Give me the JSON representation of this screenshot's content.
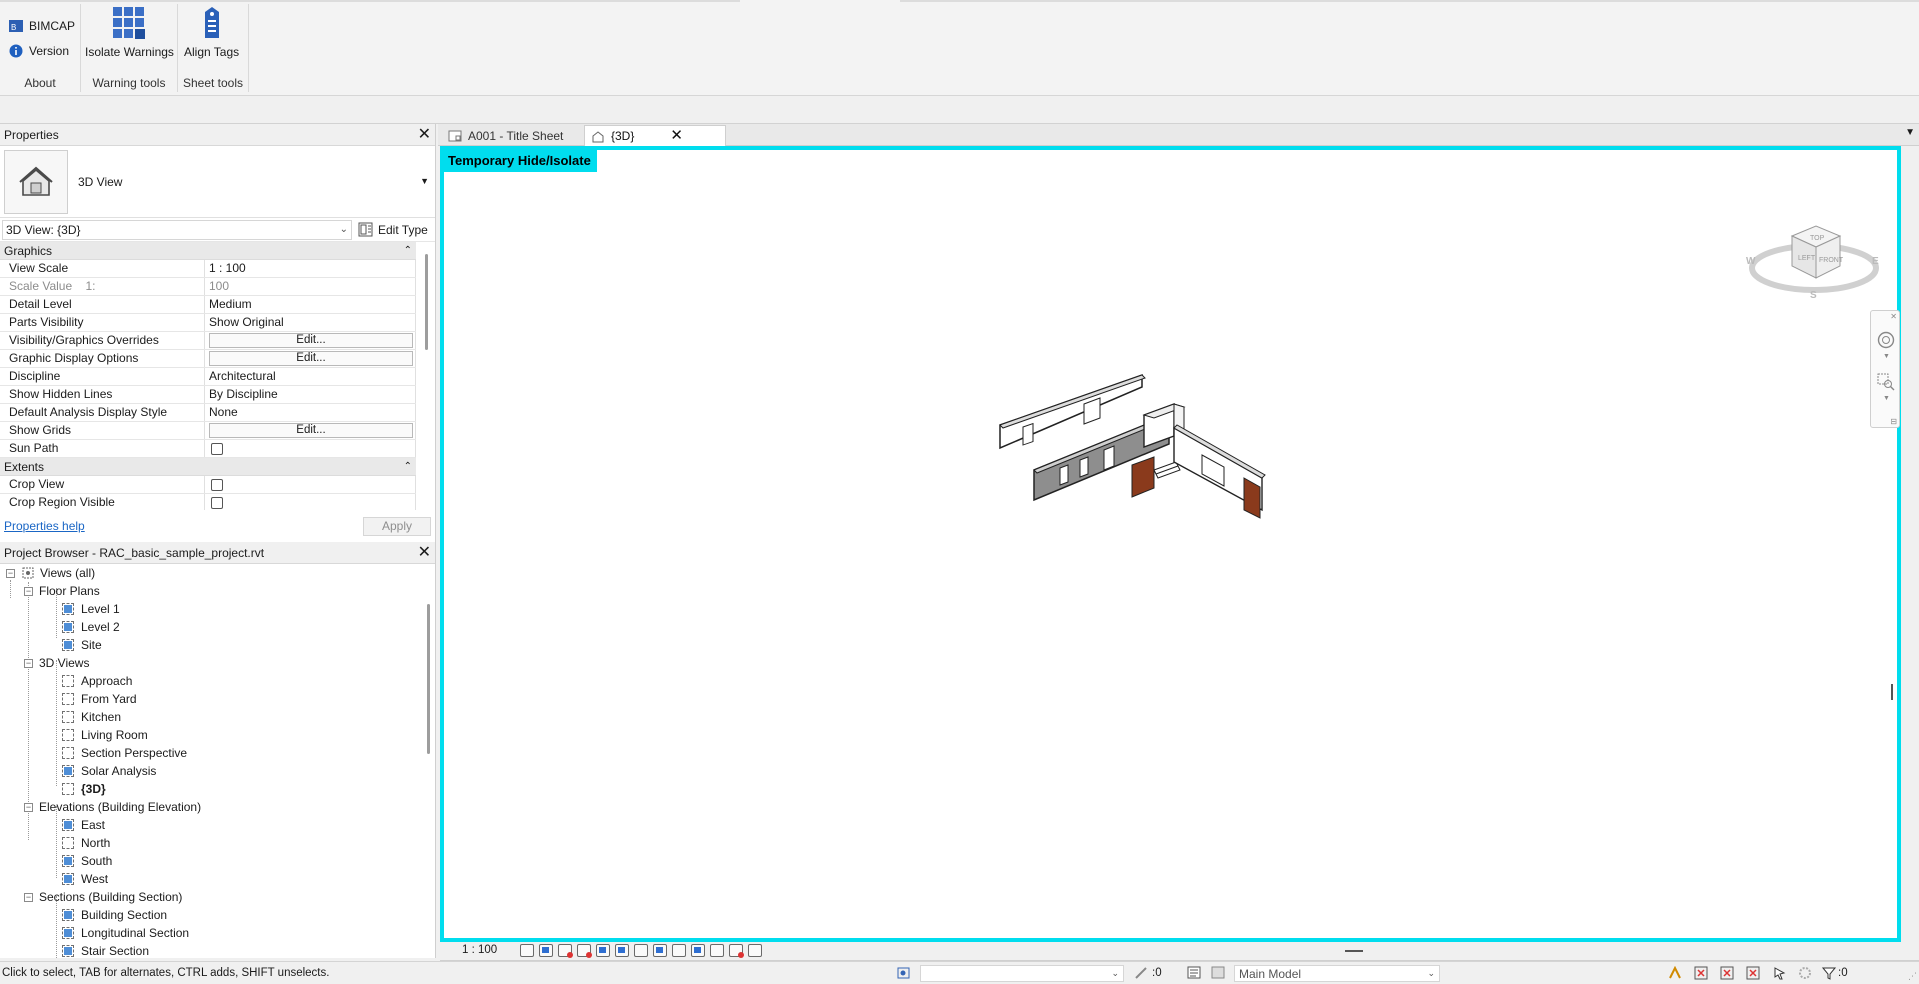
{
  "ribbon": {
    "about": {
      "bimcap_label": "BIMCAP",
      "version_label": "Version",
      "panel_title": "About"
    },
    "warning_tools": {
      "isolate_label": "Isolate Warnings",
      "panel_title": "Warning tools"
    },
    "sheet_tools": {
      "align_label": "Align Tags",
      "panel_title": "Sheet tools"
    }
  },
  "properties": {
    "title": "Properties",
    "type_name": "3D View",
    "instance_selector": "3D View: {3D}",
    "edit_type_label": "Edit Type",
    "groups": {
      "graphics": "Graphics",
      "extents": "Extents"
    },
    "rows": {
      "view_scale": {
        "name": "View Scale",
        "value": "1 : 100"
      },
      "scale_value": {
        "name": "Scale Value    1:",
        "value": "100"
      },
      "detail_level": {
        "name": "Detail Level",
        "value": "Medium"
      },
      "parts_visibility": {
        "name": "Parts Visibility",
        "value": "Show Original"
      },
      "vg_overrides": {
        "name": "Visibility/Graphics Overrides",
        "value": "Edit..."
      },
      "graphic_display": {
        "name": "Graphic Display Options",
        "value": "Edit..."
      },
      "discipline": {
        "name": "Discipline",
        "value": "Architectural"
      },
      "hidden_lines": {
        "name": "Show Hidden Lines",
        "value": "By Discipline"
      },
      "analysis_style": {
        "name": "Default Analysis Display Style",
        "value": "None"
      },
      "show_grids": {
        "name": "Show Grids",
        "value": "Edit..."
      },
      "sun_path": {
        "name": "Sun Path"
      },
      "crop_view": {
        "name": "Crop View"
      },
      "crop_region_visible": {
        "name": "Crop Region Visible"
      }
    },
    "help_link": "Properties help",
    "apply_label": "Apply"
  },
  "browser": {
    "title": "Project Browser - RAC_basic_sample_project.rvt",
    "root": "Views (all)",
    "floor_plans": {
      "label": "Floor Plans",
      "items": [
        "Level 1",
        "Level 2",
        "Site"
      ]
    },
    "views_3d": {
      "label": "3D Views",
      "items": [
        "Approach",
        "From Yard",
        "Kitchen",
        "Living Room",
        "Section Perspective",
        "Solar Analysis",
        "{3D}"
      ]
    },
    "elevations": {
      "label": "Elevations (Building Elevation)",
      "items": [
        "East",
        "North",
        "South",
        "West"
      ]
    },
    "sections": {
      "label": "Sections (Building Section)",
      "items": [
        "Building Section",
        "Longitudinal Section",
        "Stair Section"
      ]
    }
  },
  "view_tabs": {
    "tab1": "A001 - Title Sheet",
    "tab2": "{3D}"
  },
  "view": {
    "temp_hide_label": "Temporary Hide/Isolate",
    "accent_color": "#00ddee",
    "viewcube": {
      "top": "TOP",
      "left": "LEFT",
      "front": "FRONT",
      "w": "W",
      "e": "E",
      "s": "S"
    }
  },
  "view_bar": {
    "scale": "1 : 100"
  },
  "status": {
    "text": "Click to select, TAB for alternates, CTRL adds, SHIFT unselects.",
    "count_a": ":0",
    "model_combo": "Main Model",
    "filter_count": ":0"
  }
}
